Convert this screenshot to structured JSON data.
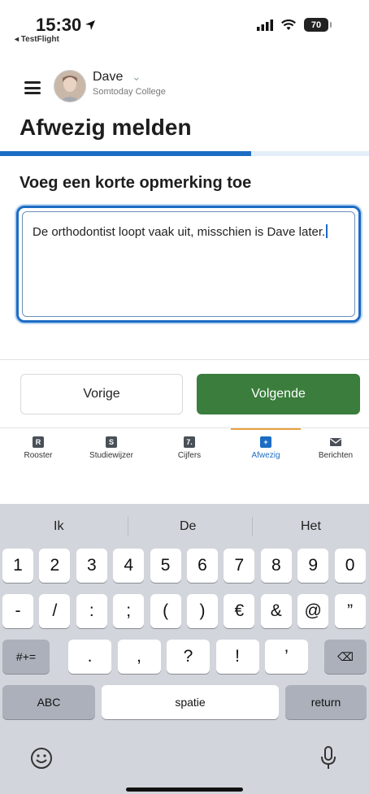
{
  "status_bar": {
    "time": "15:30",
    "back_app": "◂ TestFlight",
    "battery": "70"
  },
  "header": {
    "user_name": "Dave",
    "school": "Somtoday College"
  },
  "page": {
    "title": "Afwezig melden",
    "progress": 0.68,
    "section_heading": "Voeg een korte opmerking toe",
    "comment_value": "De orthodontist loopt vaak uit, misschien is Dave later."
  },
  "buttons": {
    "previous": "Vorige",
    "next": "Volgende"
  },
  "tabs": [
    {
      "label": "Rooster",
      "icon": "calendar-icon",
      "glyph": "R",
      "active": false
    },
    {
      "label": "Studiewijzer",
      "icon": "planner-icon",
      "glyph": "S",
      "active": false
    },
    {
      "label": "Cijfers",
      "icon": "grades-icon",
      "glyph": "7.",
      "active": false
    },
    {
      "label": "Afwezig",
      "icon": "absence-icon",
      "glyph": "+",
      "active": true
    },
    {
      "label": "Berichten",
      "icon": "mail-icon",
      "glyph": "",
      "active": false
    }
  ],
  "keyboard": {
    "suggestions": [
      "Ik",
      "De",
      "Het"
    ],
    "row1": [
      "1",
      "2",
      "3",
      "4",
      "5",
      "6",
      "7",
      "8",
      "9",
      "0"
    ],
    "row2": [
      "-",
      "/",
      ":",
      ";",
      "(",
      ")",
      "€",
      "&",
      "@",
      "”"
    ],
    "row3": [
      "#+=",
      ".",
      ",",
      "?",
      "!",
      "’",
      "⌫"
    ],
    "abc": "ABC",
    "space": "spatie",
    "return": "return"
  },
  "colors": {
    "primary": "#1c6cc4",
    "success": "#3a7d3c",
    "tab_active_indicator": "#e8a040"
  }
}
